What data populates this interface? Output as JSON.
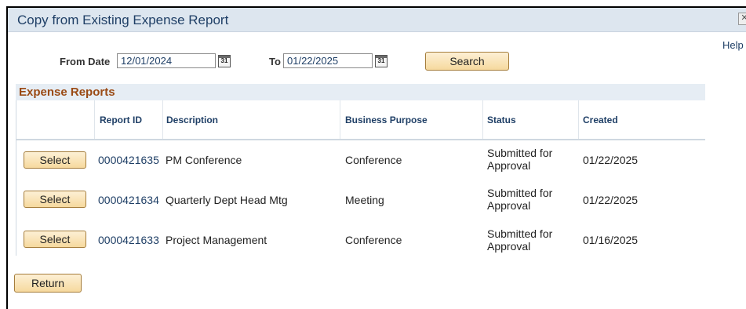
{
  "window": {
    "title": "Copy from Existing Expense Report",
    "help_label": "Help"
  },
  "filters": {
    "from_date_label": "From Date",
    "from_date_value": "12/01/2024",
    "to_label": "To",
    "to_date_value": "01/22/2025",
    "calendar_icon_text": "31",
    "search_label": "Search"
  },
  "grid": {
    "title": "Expense Reports",
    "columns": [
      "Report ID",
      "Description",
      "Business Purpose",
      "Status",
      "Created"
    ],
    "select_label": "Select",
    "rows": [
      {
        "report_id": "0000421635",
        "description": "PM Conference",
        "business_purpose": "Conference",
        "status_line1": "Submitted for",
        "status_line2": "Approval",
        "created": "01/22/2025"
      },
      {
        "report_id": "0000421634",
        "description": "Quarterly Dept Head Mtg",
        "business_purpose": "Meeting",
        "status_line1": "Submitted for",
        "status_line2": "Approval",
        "created": "01/22/2025"
      },
      {
        "report_id": "0000421633",
        "description": "Project Management",
        "business_purpose": "Conference",
        "status_line1": "Submitted for",
        "status_line2": "Approval",
        "created": "01/16/2025"
      }
    ]
  },
  "footer": {
    "return_label": "Return"
  },
  "colors": {
    "title_bar": "#dde6ef",
    "title_text": "#1f3f66",
    "grid_title": "#9a4a14",
    "button_border": "#a57d3b"
  }
}
